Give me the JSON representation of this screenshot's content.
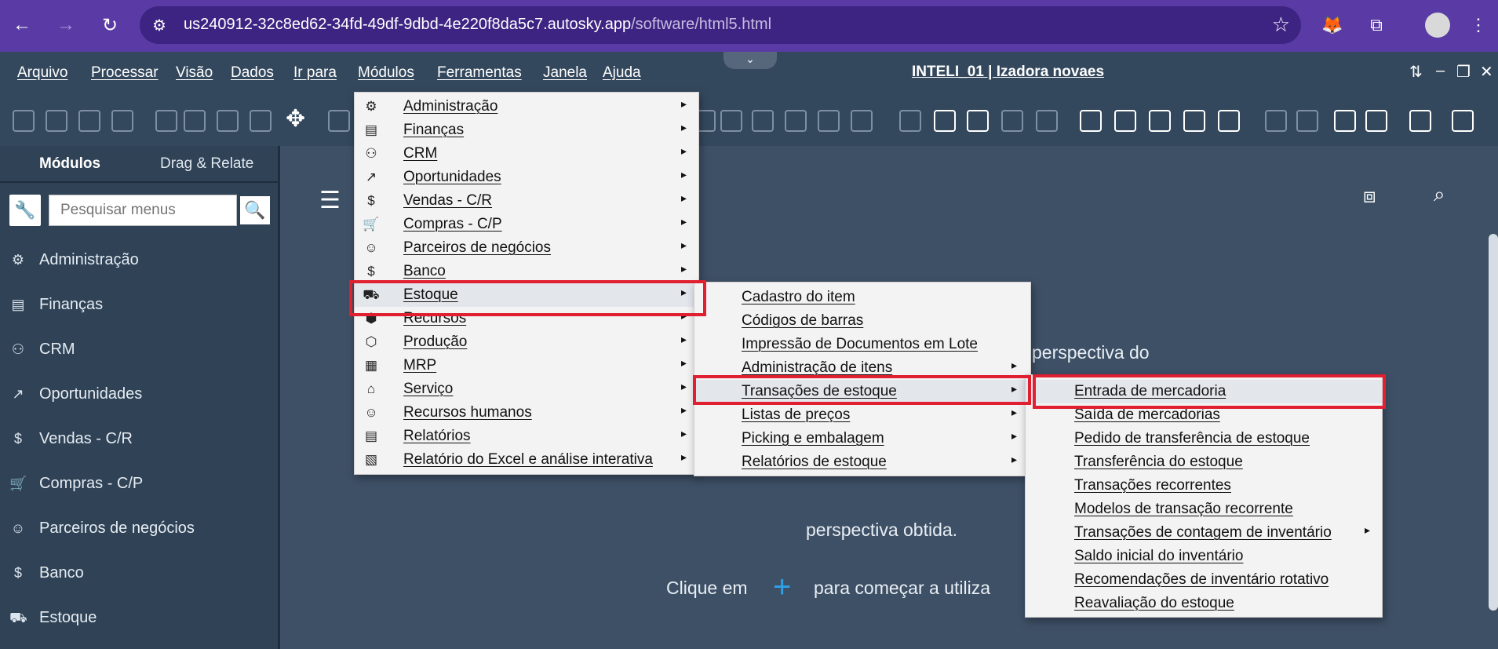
{
  "browser": {
    "back_icon": "←",
    "forward_icon": "→",
    "reload_icon": "↻",
    "site_info_icon": "⚙",
    "url_host": "us240912-32c8ed62-34fd-49df-9dbd-4e220f8da5c7.autosky.app",
    "url_path": "/software/html5.html",
    "star_icon": "☆",
    "ext_fox_icon": "🦊",
    "ext_puzzle_icon": "⧉",
    "menu_icon": "⋮"
  },
  "menubar": {
    "items": [
      "Arquivo",
      "Processar",
      "Visão",
      "Dados",
      "Ir para",
      "Módulos",
      "Ferramentas",
      "Janela",
      "Ajuda"
    ],
    "user_title": "INTELI_01 | Izadora novaes",
    "grip": "⌄",
    "window_controls": [
      "⇅",
      "–",
      "❐",
      "✕"
    ]
  },
  "left_panel": {
    "tabs": [
      "Módulos",
      "Drag & Relate"
    ],
    "search_placeholder": "Pesquisar menus",
    "wrench_icon": "🔧",
    "search_icon": "🔍",
    "items": [
      {
        "label": "Administração",
        "icon": "⚙"
      },
      {
        "label": "Finanças",
        "icon": "▤"
      },
      {
        "label": "CRM",
        "icon": "⚇"
      },
      {
        "label": "Oportunidades",
        "icon": "↗"
      },
      {
        "label": "Vendas - C/R",
        "icon": "$"
      },
      {
        "label": "Compras - C/P",
        "icon": "🛒"
      },
      {
        "label": "Parceiros de negócios",
        "icon": "☺"
      },
      {
        "label": "Banco",
        "icon": "$"
      },
      {
        "label": "Estoque",
        "icon": "⛟"
      }
    ]
  },
  "main": {
    "hamburger_icon": "☰",
    "box_icon": "⧈",
    "search_icon": "⌕",
    "welcome_line1": "perspectiva do",
    "welcome_line3": "perspectiva obtida.",
    "welcome_line4a": "Clique em",
    "plus_icon": "+",
    "welcome_line4b": "para começar a utiliza"
  },
  "menu_modulos": [
    {
      "label": "Administração",
      "icon": "⚙"
    },
    {
      "label": "Finanças",
      "icon": "▤"
    },
    {
      "label": "CRM",
      "icon": "⚇"
    },
    {
      "label": "Oportunidades",
      "icon": "↗"
    },
    {
      "label": "Vendas - C/R",
      "icon": "$"
    },
    {
      "label": "Compras - C/P",
      "icon": "🛒"
    },
    {
      "label": "Parceiros de negócios",
      "icon": "☺"
    },
    {
      "label": "Banco",
      "icon": "$"
    },
    {
      "label": "Estoque",
      "icon": "⛟"
    },
    {
      "label": "Recursos",
      "icon": "⬢"
    },
    {
      "label": "Produção",
      "icon": "⬡"
    },
    {
      "label": "MRP",
      "icon": "▦"
    },
    {
      "label": "Serviço",
      "icon": "⌂"
    },
    {
      "label": "Recursos humanos",
      "icon": "☺"
    },
    {
      "label": "Relatórios",
      "icon": "▤"
    },
    {
      "label": "Relatório do Excel e análise interativa",
      "icon": "▧"
    }
  ],
  "menu_estoque": [
    {
      "label": "Cadastro do item",
      "has_sub": false
    },
    {
      "label": "Códigos de barras",
      "has_sub": false
    },
    {
      "label": "Impressão de Documentos em Lote",
      "has_sub": false
    },
    {
      "label": "Administração de itens",
      "has_sub": true
    },
    {
      "label": "Transações de estoque",
      "has_sub": true
    },
    {
      "label": "Listas de preços",
      "has_sub": true
    },
    {
      "label": "Picking e embalagem",
      "has_sub": true
    },
    {
      "label": "Relatórios de estoque",
      "has_sub": true
    }
  ],
  "menu_transacoes": [
    {
      "label": "Entrada de mercadoria",
      "has_sub": false
    },
    {
      "label": "Saída de mercadorias",
      "has_sub": false
    },
    {
      "label": "Pedido de transferência de estoque",
      "has_sub": false
    },
    {
      "label": "Transferência do estoque",
      "has_sub": false
    },
    {
      "label": "Transações recorrentes",
      "has_sub": false
    },
    {
      "label": "Modelos de transação recorrente",
      "has_sub": false
    },
    {
      "label": "Transações de contagem de inventário",
      "has_sub": true
    },
    {
      "label": "Saldo inicial do inventário",
      "has_sub": false
    },
    {
      "label": "Recomendações de inventário rotativo",
      "has_sub": false
    },
    {
      "label": "Reavaliação do estoque",
      "has_sub": false
    }
  ],
  "submenu_arrow": "▸",
  "colors": {
    "highlight": "#e02030",
    "browser_bar": "#5a3ba5",
    "app_bar": "#34485d",
    "accent_plus": "#2ea1e8"
  }
}
